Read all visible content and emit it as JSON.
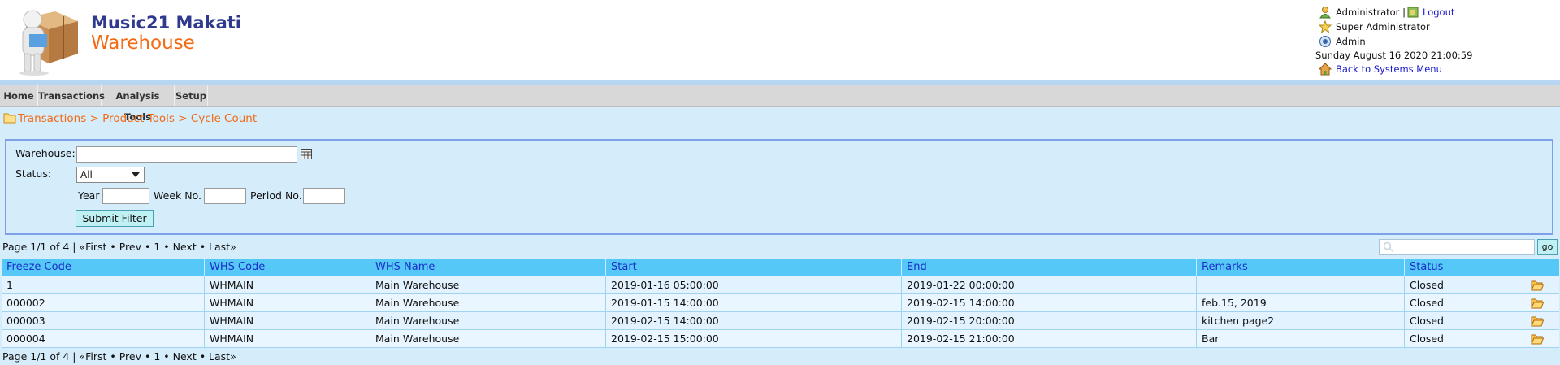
{
  "app": {
    "title": "Music21 Makati",
    "subtitle": "Warehouse"
  },
  "user": {
    "name": "Administrator",
    "separator": "|",
    "logout_label": "Logout",
    "role": "Super Administrator",
    "group": "Admin",
    "datetime": "Sunday August 16 2020 21:00:59",
    "back_label": "Back to Systems Menu"
  },
  "menu": [
    "Home",
    "Transactions",
    "Analysis Tools",
    "Setup"
  ],
  "breadcrumb": "Transactions > Product Tools > Cycle Count",
  "filter": {
    "warehouse_label": "Warehouse:",
    "warehouse_value": "",
    "status_label": "Status:",
    "status_selected": "All",
    "year_label": "Year",
    "week_label": "Week No.",
    "period_label": "Period No.",
    "submit_label": "Submit Filter"
  },
  "pager_text": "Page 1/1 of 4 | «First • Prev • 1 • Next • Last»",
  "search": {
    "value": "",
    "go_label": "go"
  },
  "table": {
    "headers": [
      "Freeze Code",
      "WHS Code",
      "WHS Name",
      "Start",
      "End",
      "Remarks",
      "Status"
    ],
    "rows": [
      [
        "1",
        "WHMAIN",
        "Main Warehouse",
        "2019-01-16 05:00:00",
        "2019-01-22 00:00:00",
        "",
        "Closed"
      ],
      [
        "000002",
        "WHMAIN",
        "Main Warehouse",
        "2019-01-15 14:00:00",
        "2019-02-15 14:00:00",
        "feb.15, 2019",
        "Closed"
      ],
      [
        "000003",
        "WHMAIN",
        "Main Warehouse",
        "2019-02-15 14:00:00",
        "2019-02-15 20:00:00",
        "kitchen page2",
        "Closed"
      ],
      [
        "000004",
        "WHMAIN",
        "Main Warehouse",
        "2019-02-15 15:00:00",
        "2019-02-15 21:00:00",
        "Bar",
        "Closed"
      ]
    ]
  },
  "colors": {
    "accent_orange": "#f26a12",
    "title_blue": "#2f3a8f",
    "table_header": "#55c8f8",
    "page_bg": "#d5ecfa"
  }
}
